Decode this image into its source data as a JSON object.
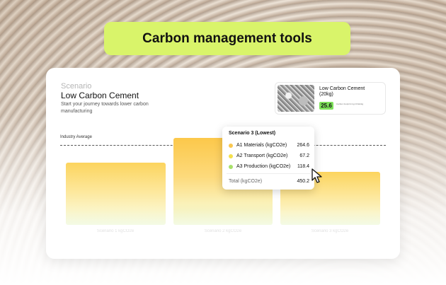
{
  "banner": {
    "title": "Carbon management tools"
  },
  "card": {
    "eyebrow": "Scenario",
    "title": "Low Carbon Cement",
    "description": "Start your journey towards lower carbon manufacturing",
    "product": {
      "name": "Low Carbon Cement (20kg)",
      "score": "25.6",
      "score_label": "Carbon footprint kg CO2e/kg"
    },
    "industry_average_label": "Industry Average",
    "scenarios": [
      {
        "label": "Scenario 1 kgCO2e"
      },
      {
        "label": "Scenario 2 kgCO2e"
      },
      {
        "label": "Scenario 3 kgCO2e"
      }
    ]
  },
  "tooltip": {
    "title": "Scenario 3 (Lowest)",
    "rows": [
      {
        "name": "A1 Materials (kgCO2e)",
        "value": "264.6",
        "color": "#f9c74f"
      },
      {
        "name": "A2 Transport (kgCO2e)",
        "value": "67.2",
        "color": "#f4e04d"
      },
      {
        "name": "A3 Production (kgCO2e)",
        "value": "118.4",
        "color": "#a8e06a"
      }
    ],
    "total_label": "Total (kgCO2e)",
    "total_value": "450.2"
  },
  "icons": {
    "cursor": "cursor-arrow-icon"
  }
}
